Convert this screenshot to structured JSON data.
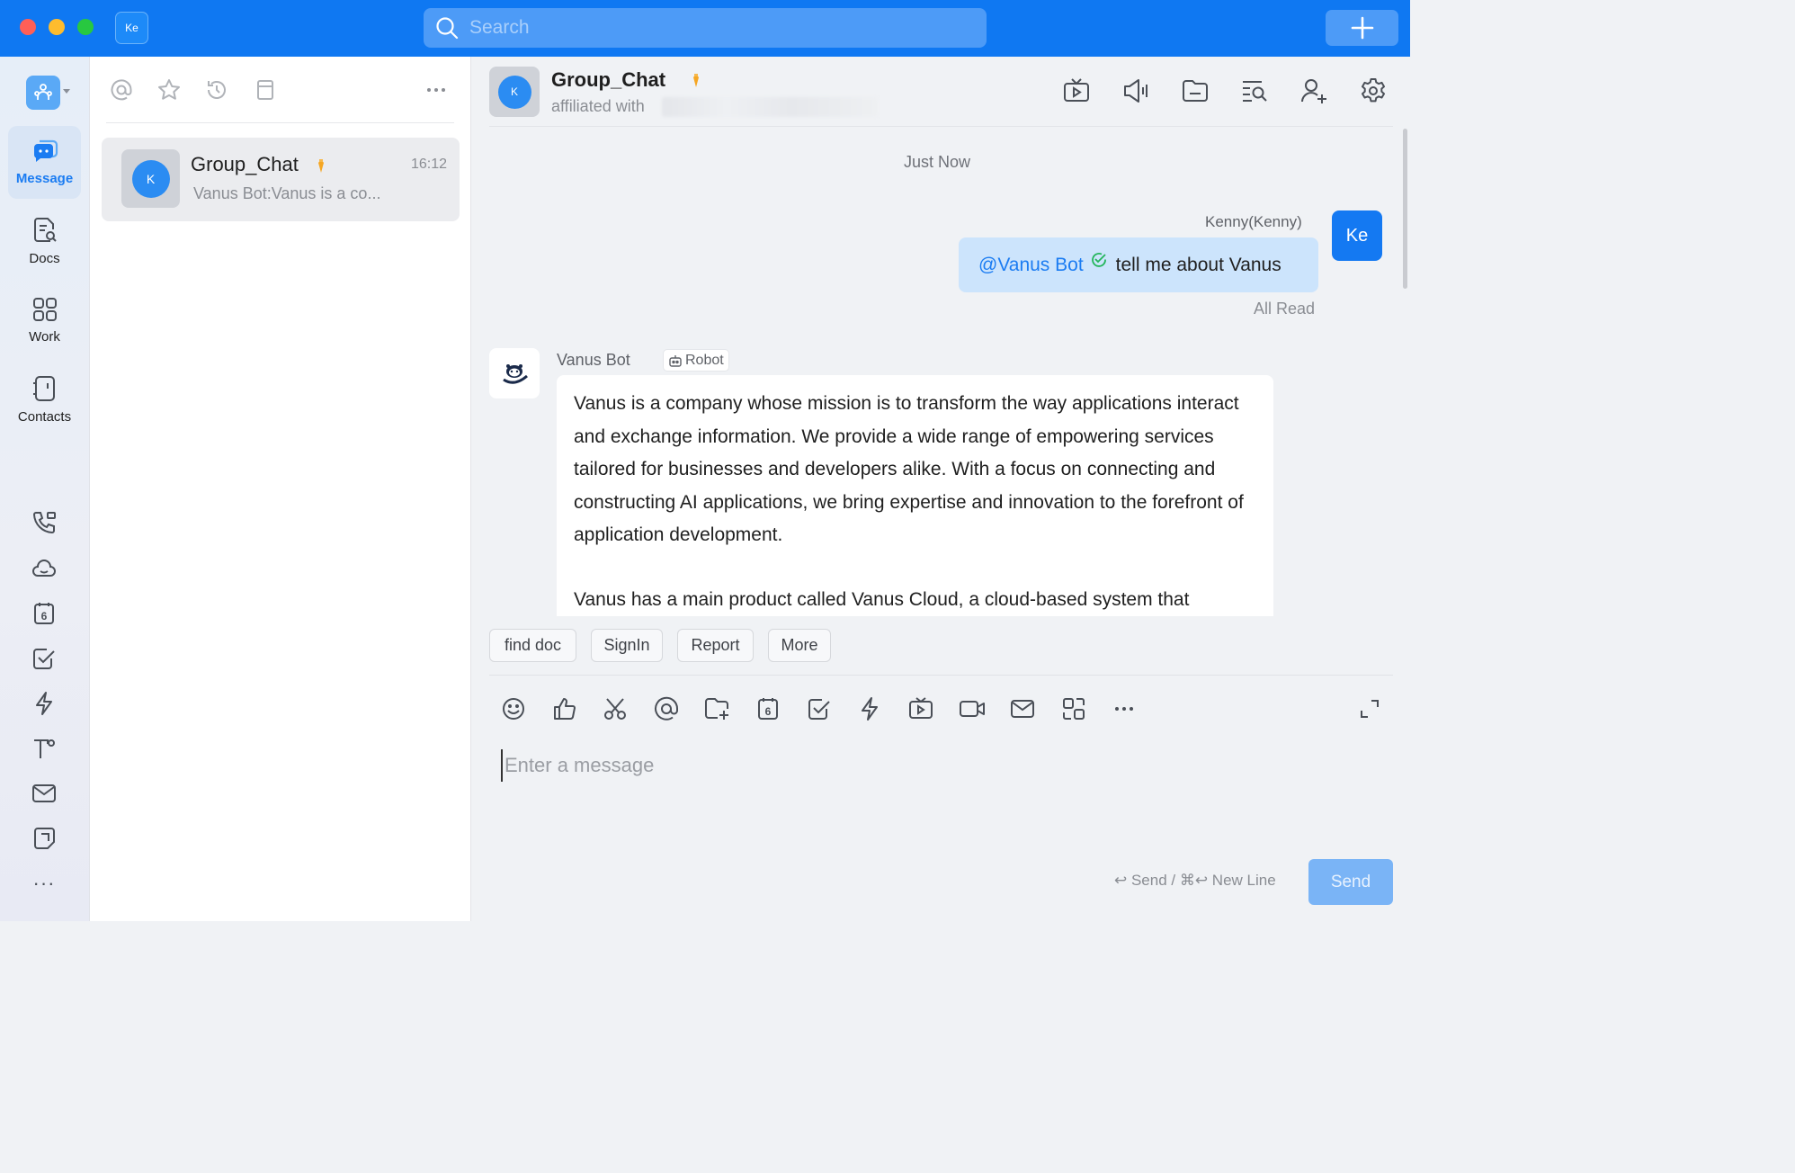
{
  "titlebar": {
    "user_initials": "Ke",
    "search_placeholder": "Search"
  },
  "rail": {
    "items": [
      {
        "label": "Message",
        "active": true
      },
      {
        "label": "Docs"
      },
      {
        "label": "Work"
      },
      {
        "label": "Contacts"
      }
    ],
    "calendar_day": "6",
    "more": "···"
  },
  "list": {
    "conversations": [
      {
        "name": "Group_Chat",
        "avatar_letter": "K",
        "time": "16:12",
        "preview": "Vanus Bot:Vanus is a co..."
      }
    ]
  },
  "chat": {
    "title": "Group_Chat",
    "avatar_letter": "K",
    "subtitle": "affiliated with",
    "time_stamp": "Just Now",
    "messages": [
      {
        "sender": "Kenny(Kenny)",
        "avatar": "Ke",
        "mention": "@Vanus Bot",
        "text": "tell me about Vanus",
        "status": "All Read"
      },
      {
        "sender": "Vanus Bot",
        "tag": "Robot",
        "paragraphs": [
          "Vanus is a company whose mission is to transform the way applications interact and exchange information. We provide a wide range of empowering services tailored for businesses and developers alike. With a focus on connecting and constructing AI applications, we bring expertise and innovation to the forefront of application development.",
          "Vanus has a main product called Vanus Cloud, a cloud-based system that"
        ]
      }
    ],
    "quick_actions": [
      "find doc",
      "SignIn",
      "Report",
      "More"
    ],
    "composer": {
      "placeholder": "Enter a message",
      "hint": "↩ Send / ⌘↩ New Line",
      "send_label": "Send",
      "calendar_day": "6"
    }
  },
  "colors": {
    "brand": "#0f78f2",
    "my_bubble": "#cce4fc",
    "mention": "#1b7cf2",
    "badge": "#f5a623",
    "send_disabled": "#7ab4f6"
  }
}
